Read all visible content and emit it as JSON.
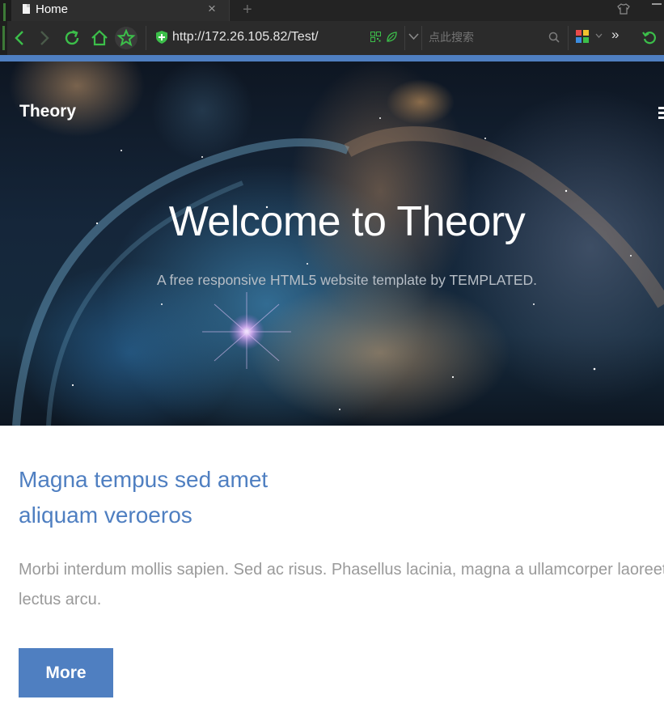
{
  "browser": {
    "tab": {
      "title": "Home",
      "close_glyph": "×",
      "new_tab_glyph": "+"
    },
    "address": {
      "url": "http://172.26.105.82/Test/"
    },
    "search": {
      "placeholder": "点此搜索"
    },
    "extensions_overflow": "»",
    "icons": [
      "back-icon",
      "forward-icon",
      "reload-icon",
      "home-icon",
      "favorite-star-icon",
      "security-shield-icon",
      "qr-code-icon",
      "leaf-icon",
      "chevron-down-icon",
      "search-icon",
      "apps-grid-icon",
      "undo-icon",
      "skin-shirt-icon",
      "minimize-icon"
    ],
    "accent_color": "#3cbf4a"
  },
  "hero": {
    "brand": "Theory",
    "title": "Welcome to Theory",
    "subtitle": "A free responsive HTML5 website template by TEMPLATED.",
    "menu_icon": "hamburger-menu-icon"
  },
  "content": {
    "heading_line1": "Magna tempus sed amet",
    "heading_line2": "aliquam veroeros",
    "paragraph": "Morbi interdum mollis sapien. Sed ac risus. Phasellus lacinia, magna a ullamcorper laoreet, lectus arcu.",
    "button_label": "More"
  },
  "colors": {
    "brand_blue": "#4f7fc1",
    "body_text": "#9a9a9a",
    "chrome_dark": "#2b2b2b"
  }
}
